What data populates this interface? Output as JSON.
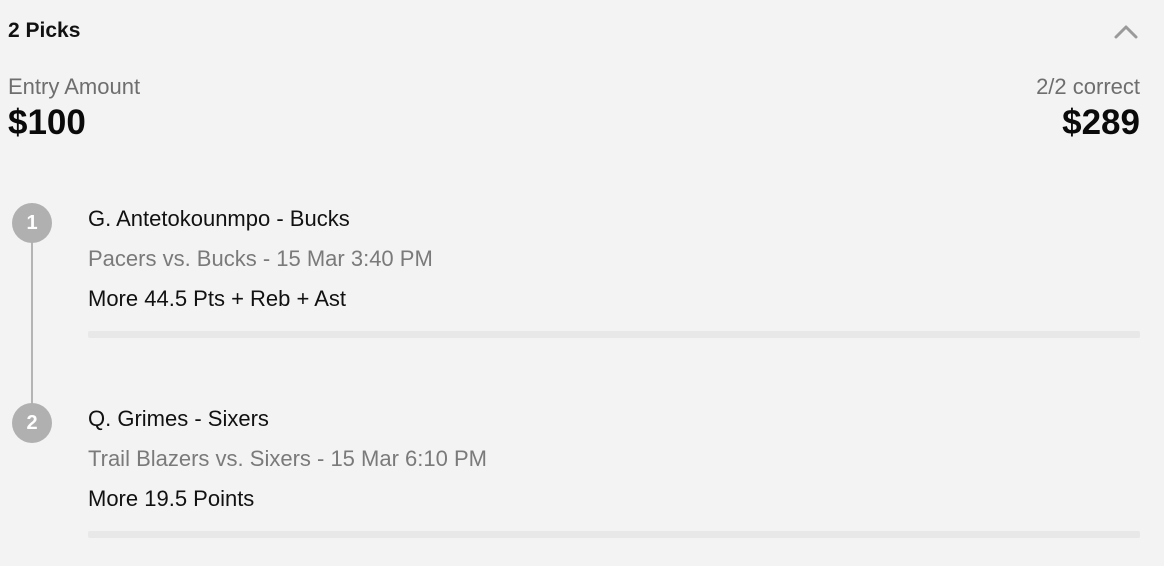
{
  "header": {
    "title": "2 Picks",
    "collapse_icon": "chevron-up-icon"
  },
  "summary": {
    "entry_label": "Entry Amount",
    "entry_value": "$100",
    "result_label": "2/2 correct",
    "result_value": "$289"
  },
  "picks": [
    {
      "number": "1",
      "player": "G. Antetokounmpo - Bucks",
      "game": "Pacers vs. Bucks - 15 Mar 3:40 PM",
      "line": "More 44.5 Pts + Reb + Ast"
    },
    {
      "number": "2",
      "player": "Q. Grimes - Sixers",
      "game": "Trail Blazers vs. Sixers - 15 Mar 6:10 PM",
      "line": "More 19.5 Points"
    }
  ],
  "colors": {
    "background": "#f3f3f3",
    "badge": "#b0b0b0",
    "muted_text": "#7a7a7a"
  }
}
